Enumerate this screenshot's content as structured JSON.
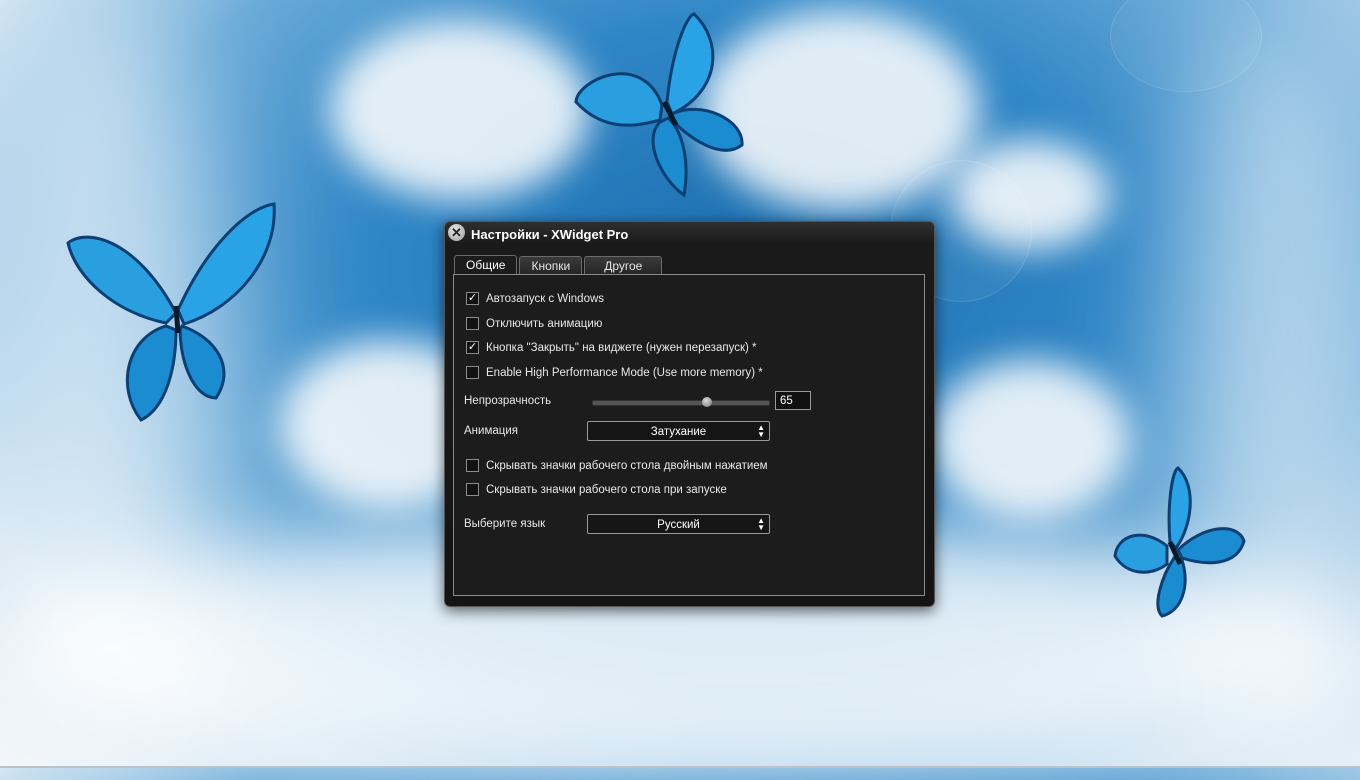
{
  "dialog": {
    "title": "Настройки - XWidget Pro",
    "close_glyph": "✕"
  },
  "tabs": [
    {
      "label": "Общие",
      "active": true
    },
    {
      "label": "Кнопки",
      "active": false
    },
    {
      "label": "Другое",
      "active": false
    }
  ],
  "general": {
    "autostart": {
      "label": "Автозапуск с Windows",
      "checked": true
    },
    "disable_animation": {
      "label": "Отключить анимацию",
      "checked": false
    },
    "close_button": {
      "label": "Кнопка \"Закрыть\" на виджете (нужен перезапуск) *",
      "checked": true
    },
    "high_performance": {
      "label": "Enable High Performance Mode (Use more memory) *",
      "checked": false
    },
    "opacity": {
      "label": "Непрозрачность",
      "value": "65",
      "fraction": 0.65
    },
    "animation": {
      "label": "Анимация",
      "selected": "Затухание"
    },
    "hide_icons_dblclick": {
      "label": "Скрывать значки рабочего стола двойным нажатием",
      "checked": false
    },
    "hide_icons_startup": {
      "label": "Скрывать значки рабочего стола при запуске",
      "checked": false
    },
    "language": {
      "label": "Выберите язык",
      "selected": "Русский"
    }
  },
  "check_glyph": "✓",
  "colors": {
    "butterfly": "#2a9fe0",
    "butterfly_dark": "#0c3f73",
    "dialog_bg": "#1c1c1c"
  }
}
